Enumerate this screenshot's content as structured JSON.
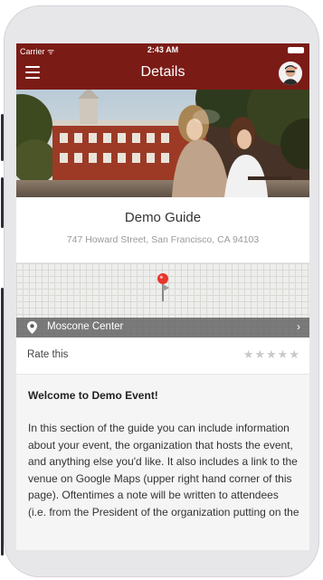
{
  "status_bar": {
    "carrier": "Carrier ᯤ",
    "time": "2:43 AM"
  },
  "navbar": {
    "title": "Details",
    "menu_icon": "hamburger-icon",
    "avatar": "user-avatar"
  },
  "event": {
    "name": "Demo Guide",
    "address": "747 Howard Street, San Francisco, CA 94103"
  },
  "map": {
    "venue": "Moscone Center",
    "pin_icon": "map-pin-icon",
    "location_icon": "location-marker-icon",
    "chevron": "›"
  },
  "rating": {
    "label": "Rate this",
    "stars": "★★★★★",
    "max": 5,
    "value": 0
  },
  "content": {
    "heading": "Welcome to Demo Event!",
    "body": "In this section of the guide you can include information about your event, the organization that hosts the event, and anything else you'd like.  It also includes a link to the venue on Google Maps (upper right hand corner of this page).  Oftentimes a note will be written to attendees (i.e. from the President of the organization putting on the"
  },
  "colors": {
    "brand": "#7b1b16",
    "background": "#f5f5f5"
  }
}
